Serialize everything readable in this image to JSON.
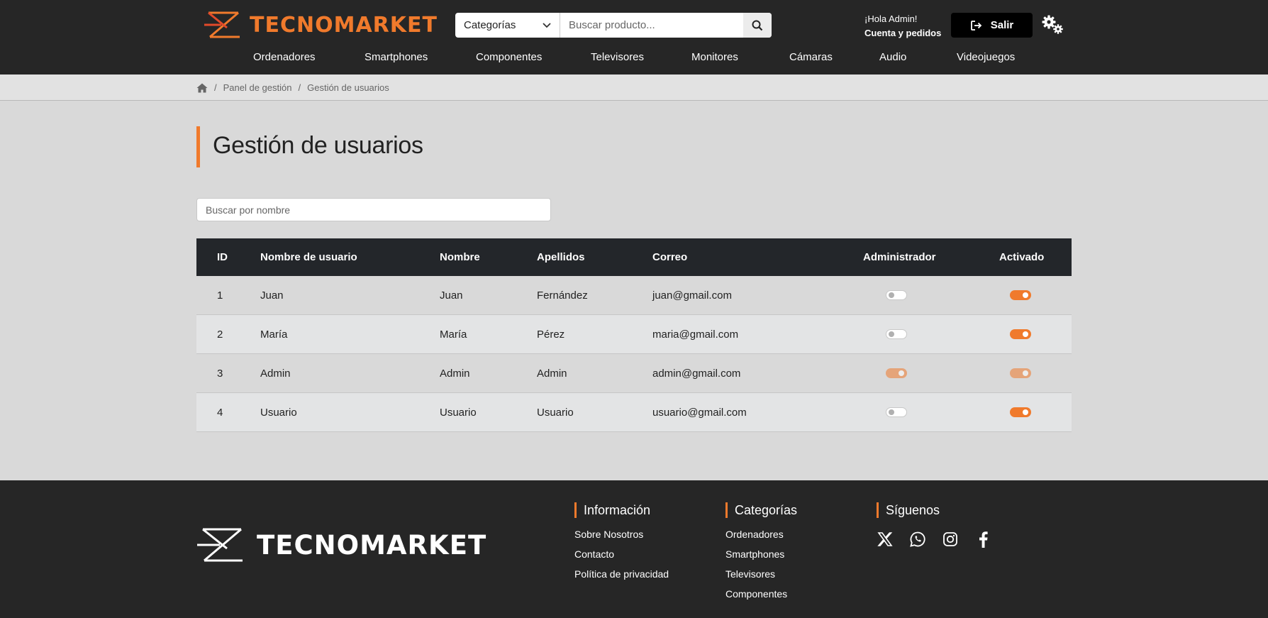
{
  "header": {
    "logo_text": "TECNOMARKET",
    "category_select": "Categorías",
    "search_placeholder": "Buscar producto...",
    "greeting": "¡Hola Admin!",
    "account_link": "Cuenta y pedidos",
    "logout_label": "Salir"
  },
  "nav": [
    "Ordenadores",
    "Smartphones",
    "Componentes",
    "Televisores",
    "Monitores",
    "Cámaras",
    "Audio",
    "Videojuegos"
  ],
  "breadcrumb": {
    "items": [
      "Panel de gestión",
      "Gestión de usuarios"
    ],
    "separator": "/"
  },
  "page_title": "Gestión de usuarios",
  "filter_placeholder": "Buscar por nombre",
  "table": {
    "headers": [
      "ID",
      "Nombre de usuario",
      "Nombre",
      "Apellidos",
      "Correo",
      "Administrador",
      "Activado"
    ],
    "rows": [
      {
        "id": "1",
        "username": "Juan",
        "name": "Juan",
        "surname": "Fernández",
        "email": "juan@gmail.com",
        "admin": false,
        "active": true,
        "disabled": false
      },
      {
        "id": "2",
        "username": "María",
        "name": "María",
        "surname": "Pérez",
        "email": "maria@gmail.com",
        "admin": false,
        "active": true,
        "disabled": false
      },
      {
        "id": "3",
        "username": "Admin",
        "name": "Admin",
        "surname": "Admin",
        "email": "admin@gmail.com",
        "admin": true,
        "active": true,
        "disabled": true
      },
      {
        "id": "4",
        "username": "Usuario",
        "name": "Usuario",
        "surname": "Usuario",
        "email": "usuario@gmail.com",
        "admin": false,
        "active": true,
        "disabled": false
      }
    ]
  },
  "footer": {
    "logo_text": "TECNOMARKET",
    "info": {
      "title": "Información",
      "links": [
        "Sobre Nosotros",
        "Contacto",
        "Política de privacidad"
      ]
    },
    "categories": {
      "title": "Categorías",
      "links": [
        "Ordenadores",
        "Smartphones",
        "Televisores",
        "Componentes"
      ]
    },
    "social": {
      "title": "Síguenos",
      "icons": [
        "x-icon",
        "whatsapp-icon",
        "instagram-icon",
        "facebook-icon"
      ]
    }
  },
  "colors": {
    "accent": "#f07a2c",
    "header_bg": "#262626",
    "table_header_bg": "#23262a",
    "page_bg": "#d9d9d9"
  }
}
